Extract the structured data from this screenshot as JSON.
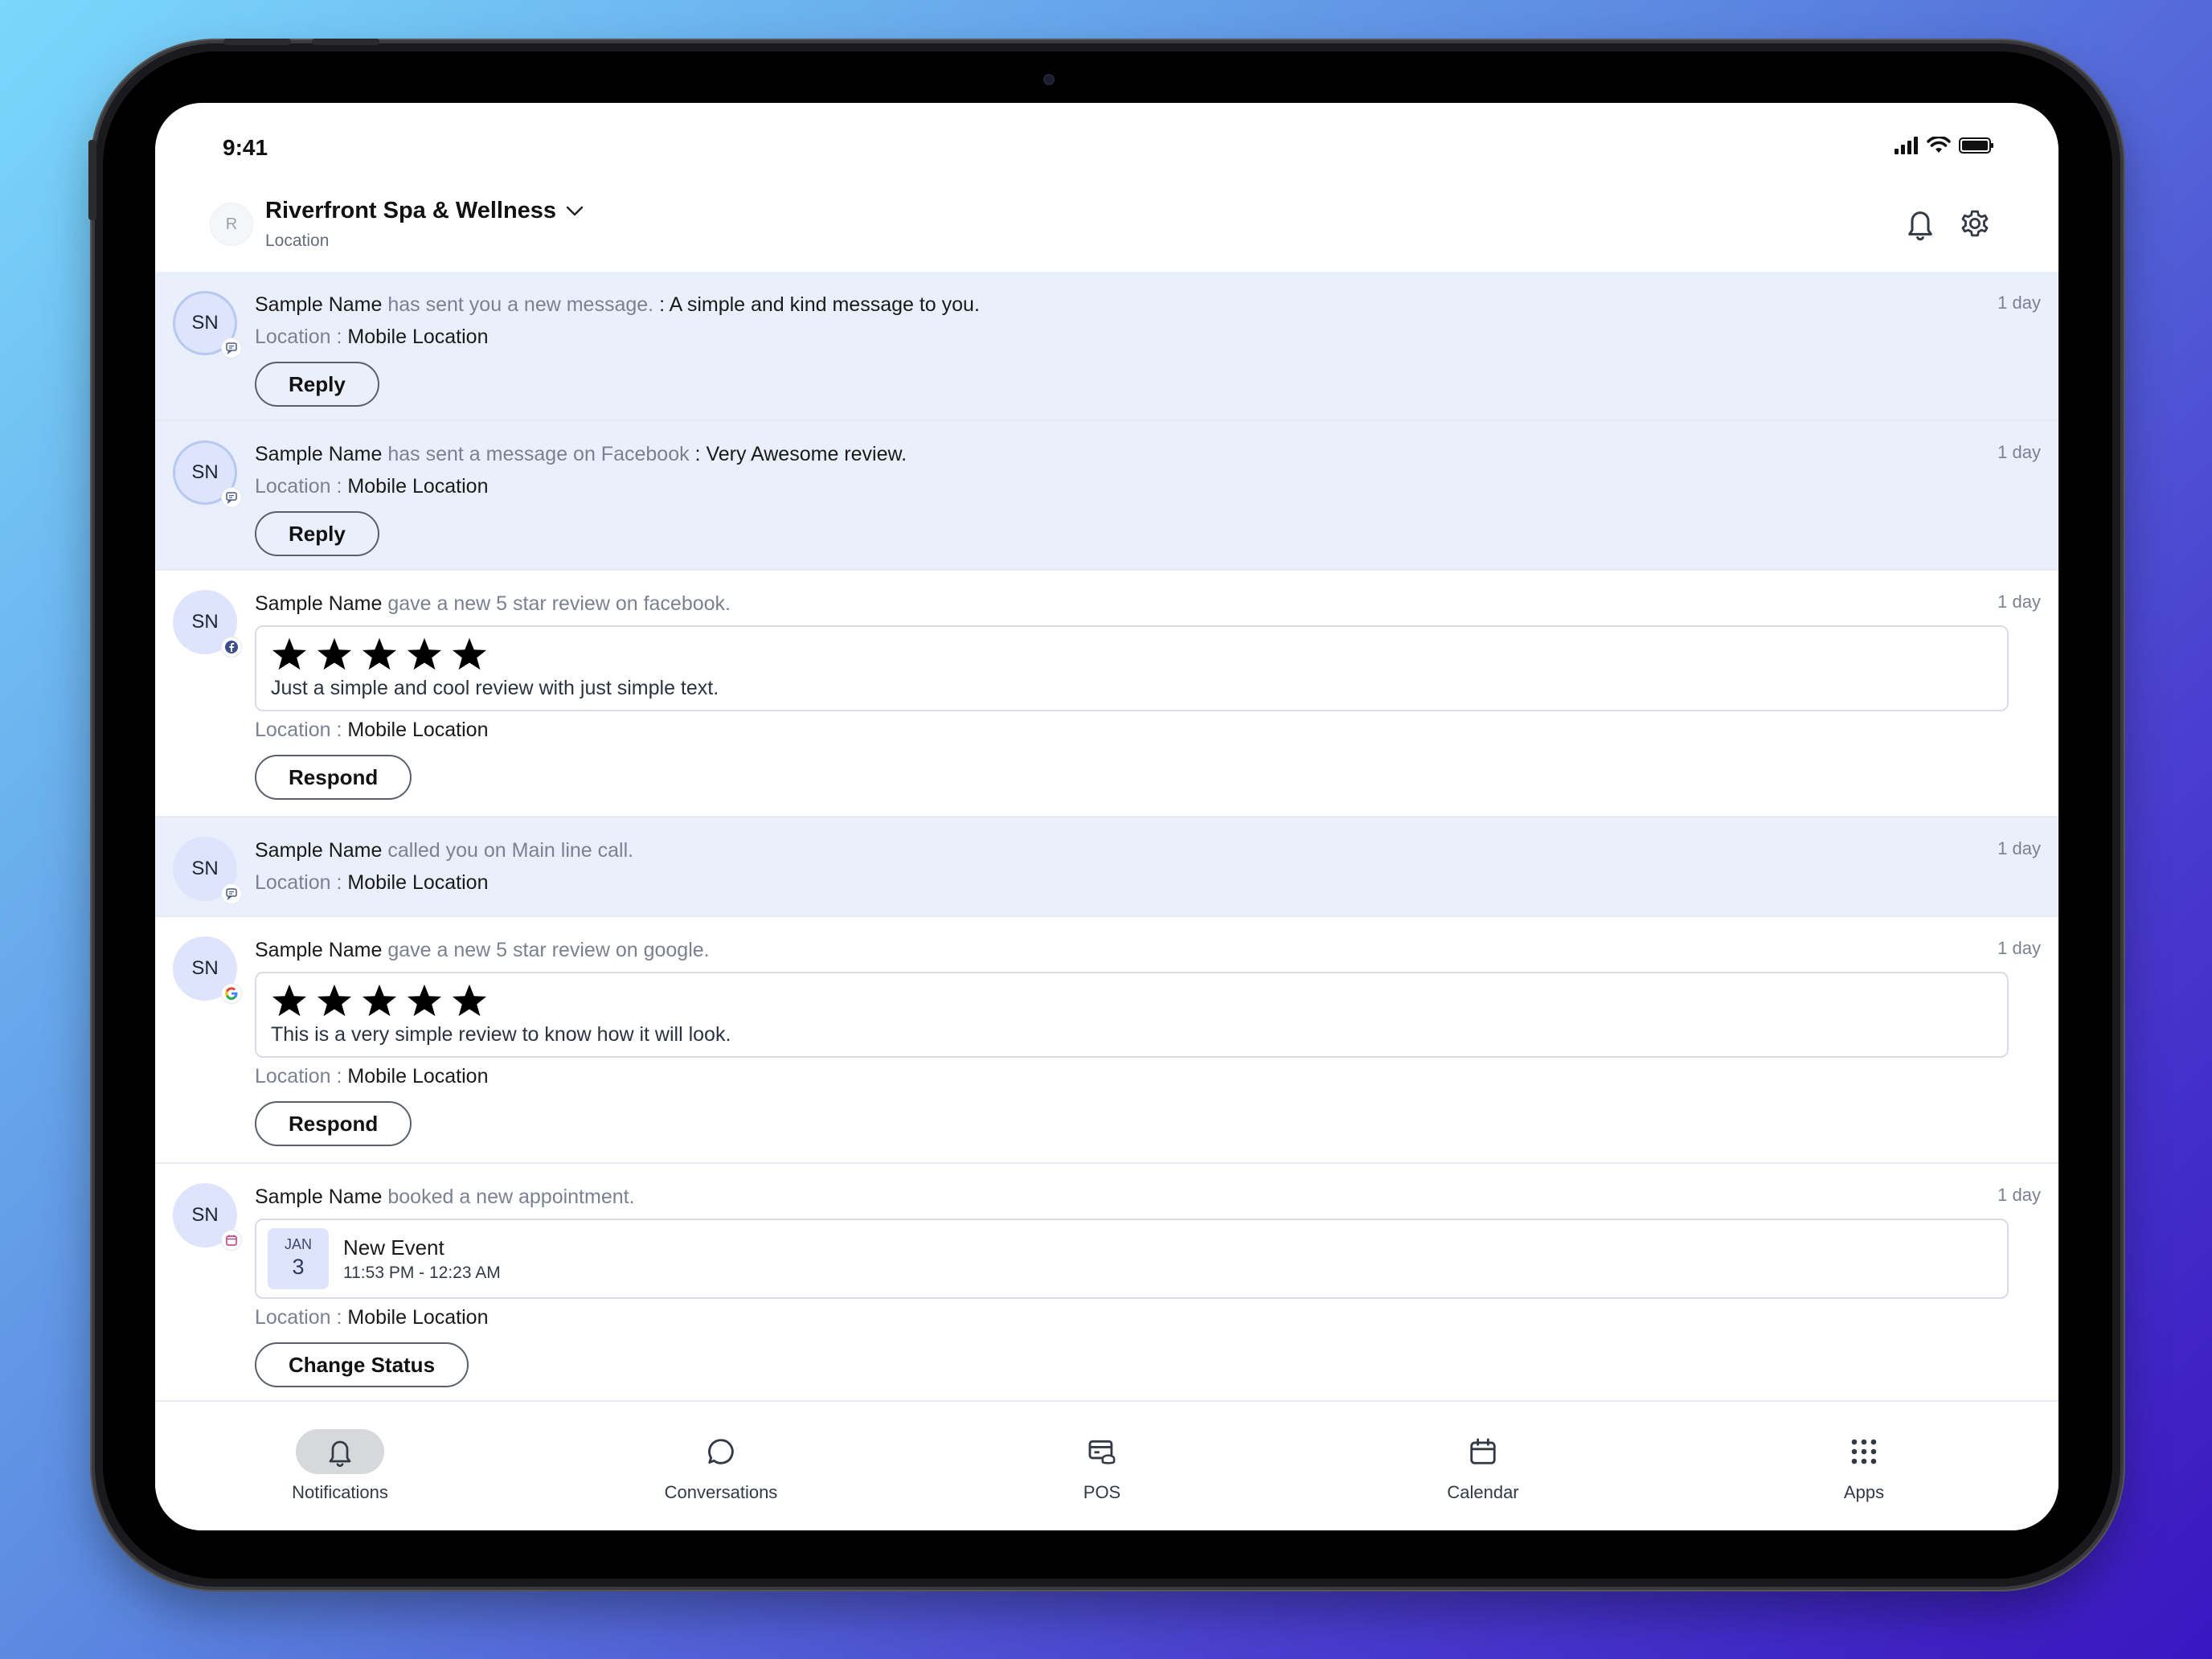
{
  "status_bar": {
    "time": "9:41"
  },
  "header": {
    "avatar_initial": "R",
    "location_name": "Riverfront Spa & Wellness",
    "location_label": "Location"
  },
  "notifications": [
    {
      "initials": "SN",
      "name": "Sample Name",
      "action": "has sent you a new message.",
      "message": ": A simple and kind message to you.",
      "time": "1 day",
      "location_label": "Location :",
      "location": "Mobile Location",
      "button": "Reply",
      "badge_icon": "chat-icon",
      "unread": true
    },
    {
      "initials": "SN",
      "name": "Sample Name",
      "action": "has sent a message on Facebook",
      "message": ": Very Awesome review.",
      "time": "1 day",
      "location_label": "Location :",
      "location": "Mobile Location",
      "button": "Reply",
      "badge_icon": "chat-icon",
      "unread": true
    },
    {
      "initials": "SN",
      "name": "Sample Name",
      "action": "gave a new 5 star review on facebook.",
      "time": "1 day",
      "rating": 5,
      "review": "Just a simple and cool review with just simple text.",
      "location_label": "Location :",
      "location": "Mobile Location",
      "button": "Respond",
      "badge_icon": "facebook-icon",
      "unread": false
    },
    {
      "initials": "SN",
      "name": "Sample Name",
      "action": "called you on Main line call.",
      "time": "1 day",
      "location_label": "Location :",
      "location": "Mobile Location",
      "badge_icon": "chat-icon",
      "unread": true
    },
    {
      "initials": "SN",
      "name": "Sample Name",
      "action": "gave a new 5 star review on google.",
      "time": "1 day",
      "rating": 5,
      "review": "This is a very simple review to know how it will look.",
      "location_label": "Location :",
      "location": "Mobile Location",
      "button": "Respond",
      "badge_icon": "google-icon",
      "unread": false
    },
    {
      "initials": "SN",
      "name": "Sample Name",
      "action": "booked a new appointment.",
      "time": "1 day",
      "appointment": {
        "month": "JAN",
        "day": "3",
        "title": "New Event",
        "time": "11:53 PM - 12:23 AM"
      },
      "location_label": "Location :",
      "location": "Mobile Location",
      "button": "Change Status",
      "badge_icon": "calendar-icon",
      "unread": false
    }
  ],
  "tabbar": {
    "tabs": [
      {
        "label": "Notifications",
        "icon": "bell-icon",
        "active": true
      },
      {
        "label": "Conversations",
        "icon": "chat-bubble-icon",
        "active": false
      },
      {
        "label": "POS",
        "icon": "pos-icon",
        "active": false
      },
      {
        "label": "Calendar",
        "icon": "calendar-icon",
        "active": false
      },
      {
        "label": "Apps",
        "icon": "apps-grid-icon",
        "active": false
      }
    ]
  },
  "colors": {
    "unread_bg": "#eaeffc",
    "avatar_bg": "#dde4fb",
    "active_tab_bg": "#d6d8dc"
  }
}
